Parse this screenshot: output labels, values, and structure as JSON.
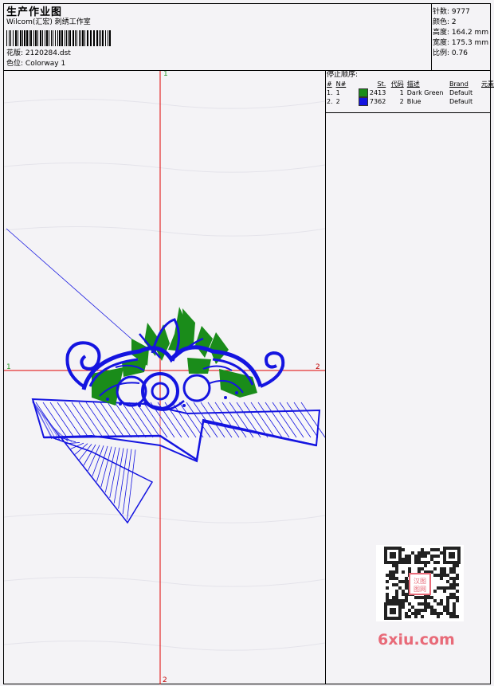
{
  "header": {
    "title": "生产作业图",
    "company": "Wilcom(汇宏) 刺绣工作室",
    "design_label": "花版:",
    "design_value": "2120284.dst",
    "colorway_label": "色位:",
    "colorway_value": "Colorway 1"
  },
  "stats": {
    "stitches_label": "针数:",
    "stitches_value": "9777",
    "colors_label": "颜色:",
    "colors_value": "2",
    "height_label": "高度:",
    "height_value": "164.2 mm",
    "width_label": "宽度:",
    "width_value": "175.3 mm",
    "scale_label": "比例:",
    "scale_value": "0.76"
  },
  "stop_sequence": {
    "title": "停止顺序:",
    "headers": [
      "#",
      "N#",
      "St.",
      "代码",
      "描述",
      "Brand",
      "元素"
    ],
    "rows": [
      {
        "idx": "1.",
        "n": "1",
        "st": "2413",
        "code": "1",
        "desc": "Dark Green",
        "brand": "Default",
        "color": "#1a8c1a"
      },
      {
        "idx": "2.",
        "n": "2",
        "st": "7362",
        "code": "2",
        "desc": "Blue",
        "brand": "Default",
        "color": "#1414e0"
      }
    ]
  },
  "canvas": {
    "markers": {
      "top": "1",
      "left": "1",
      "right": "2",
      "bottom": "2"
    },
    "crosshair_color": "#e00000",
    "thread_colors": {
      "green": "#1a8c1a",
      "blue": "#1414e0"
    }
  },
  "watermark": {
    "text": "6xiu.com",
    "seal_text": "汉图 图网"
  }
}
